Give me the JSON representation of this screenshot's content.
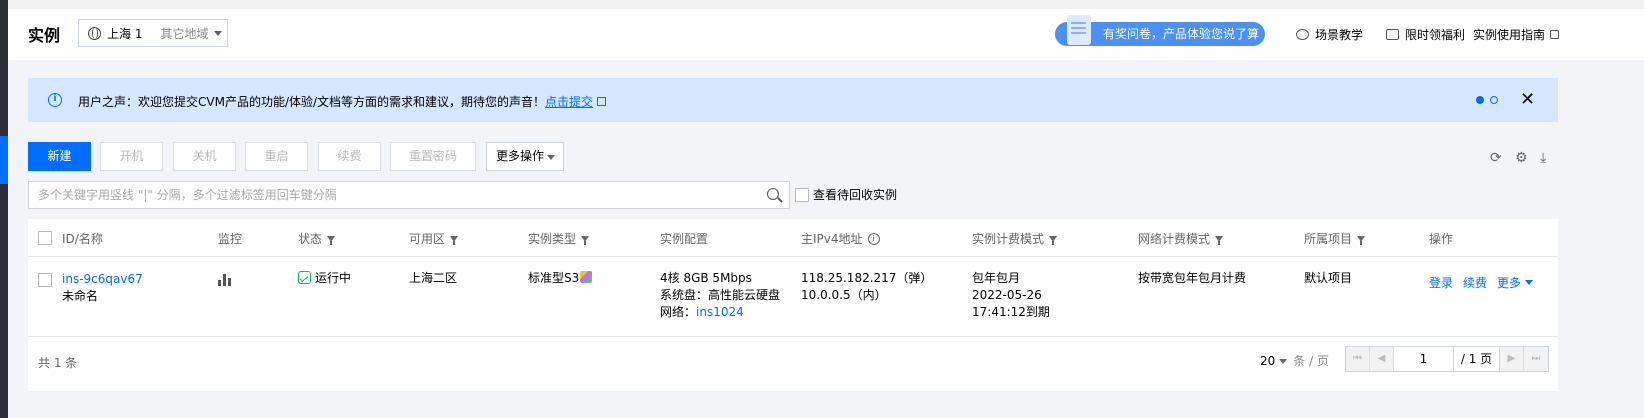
{
  "header": {
    "title": "实例",
    "region_current": "上海 1",
    "region_other": "其它地域",
    "survey_label": "有奖问卷，产品体验您说了算",
    "links": [
      {
        "label": "场景教学",
        "icon": "eye-slash-icon"
      },
      {
        "label": "限时领福利",
        "icon": "gift-icon"
      },
      {
        "label": "实例使用指南",
        "icon": "external-link-icon"
      }
    ]
  },
  "notice": {
    "message": "用户之声：欢迎您提交CVM产品的功能/体验/文档等方面的需求和建议，期待您的声音！",
    "link_text": "点击提交"
  },
  "toolbar": {
    "new": "新建",
    "start": "开机",
    "stop": "关机",
    "restart": "重启",
    "renew": "续费",
    "reset_password": "重置密码",
    "more_actions": "更多操作"
  },
  "search": {
    "placeholder": "多个关键字用竖线 \"|\" 分隔，多个过滤标签用回车键分隔",
    "value": ""
  },
  "recycle_label": "查看待回收实例",
  "table": {
    "headers": {
      "id_name": "ID/名称",
      "monitor": "监控",
      "status": "状态",
      "zone": "可用区",
      "instance_type": "实例类型",
      "config": "实例配置",
      "ipv4": "主IPv4地址",
      "billing_mode": "实例计费模式",
      "net_billing_mode": "网络计费模式",
      "project": "所属项目",
      "actions": "操作"
    },
    "rows": [
      {
        "id": "ins-9c6qav67",
        "name": "未命名",
        "status": "运行中",
        "zone": "上海二区",
        "instance_type": "标准型S3",
        "config_line1": "4核 8GB 5Mbps",
        "config_line2": "系统盘：高性能云硬盘",
        "config_net_label": "网络：",
        "config_net": "ins1024",
        "ip_public": "118.25.182.217（弹）",
        "ip_private": "10.0.0.5（内）",
        "billing_line1": "包年包月",
        "billing_line2": "2022-05-26",
        "billing_line3": "17:41:12到期",
        "net_billing": "按带宽包年包月计费",
        "project": "默认项目",
        "action_login": "登录",
        "action_renew": "续费",
        "action_more": "更多"
      }
    ]
  },
  "footer": {
    "total": "共 1 条",
    "page_size": "20",
    "page_size_unit": "条 / 页",
    "page_current": "1",
    "page_total": "/ 1 页"
  },
  "colors": {
    "primary": "#006eff",
    "running": "#0abf5b",
    "notice_bg": "#d5e7fe"
  }
}
